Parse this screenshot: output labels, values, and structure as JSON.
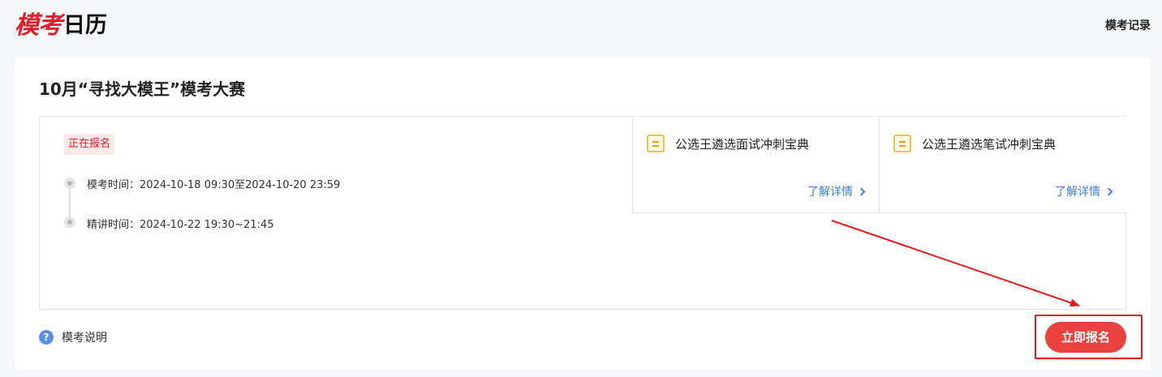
{
  "header": {
    "logo_hand": "模考",
    "logo_plain": "日历",
    "record_link": "模考记录"
  },
  "exam": {
    "title": "10月“寻找大模王”模考大赛",
    "status_badge": "正在报名",
    "timeline": [
      {
        "label": "模考时间：2024-10-18 09:30至2024-10-20 23:59"
      },
      {
        "label": "精讲时间：2024-10-22 19:30~21:45"
      }
    ],
    "books": [
      {
        "title": "公选王遴选面试冲刺宝典",
        "link": "了解详情"
      },
      {
        "title": "公选王遴选笔试冲刺宝典",
        "link": "了解详情"
      }
    ],
    "help_label": "模考说明",
    "help_icon_glyph": "?",
    "signup_button": "立即报名"
  },
  "colors": {
    "accent_red": "#e8413e",
    "badge_text": "#e0202a",
    "link_blue": "#3f7fd8",
    "annotation_red": "#e41b1b"
  },
  "icons": [
    "document-icon",
    "chevron-right-icon",
    "question-circle-icon"
  ]
}
